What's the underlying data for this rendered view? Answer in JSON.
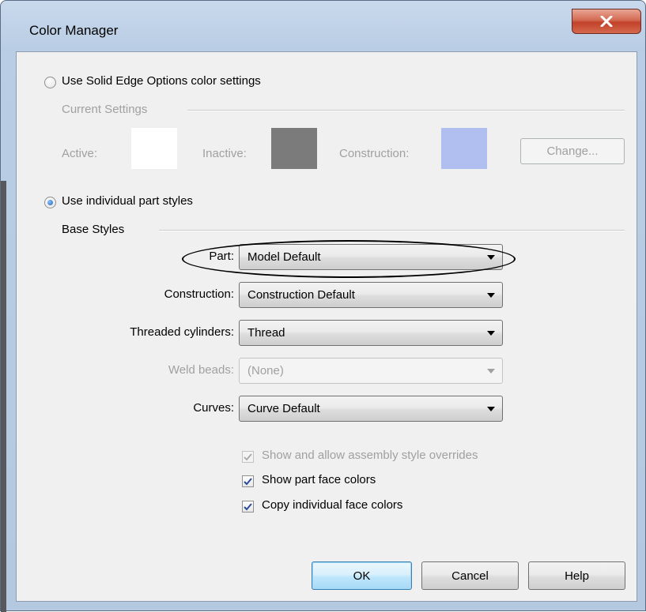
{
  "window": {
    "title": "Color Manager",
    "close_label": "x"
  },
  "options_radio": {
    "label": "Use Solid Edge Options color settings",
    "selected": false,
    "group_label": "Current Settings",
    "active_label": "Active:",
    "inactive_label": "Inactive:",
    "construction_label": "Construction:",
    "change_button": "Change...",
    "active_color": "#ffffff",
    "inactive_color": "#7b7b7b",
    "construction_color": "#b0bff0"
  },
  "individual_radio": {
    "label": "Use individual part styles",
    "selected": true
  },
  "base_styles": {
    "group_label": "Base Styles",
    "rows": [
      {
        "label": "Part:",
        "value": "Model Default",
        "enabled": true
      },
      {
        "label": "Construction:",
        "value": "Construction Default",
        "enabled": true
      },
      {
        "label": "Threaded cylinders:",
        "value": "Thread",
        "enabled": true
      },
      {
        "label": "Weld beads:",
        "value": "(None)",
        "enabled": false
      },
      {
        "label": "Curves:",
        "value": "Curve Default",
        "enabled": true
      }
    ]
  },
  "checkboxes": [
    {
      "label": "Show and allow assembly style overrides",
      "checked": true,
      "enabled": false
    },
    {
      "label": "Show part face colors",
      "checked": true,
      "enabled": true
    },
    {
      "label": "Copy individual face colors",
      "checked": true,
      "enabled": true
    }
  ],
  "buttons": {
    "ok": "OK",
    "cancel": "Cancel",
    "help": "Help"
  }
}
